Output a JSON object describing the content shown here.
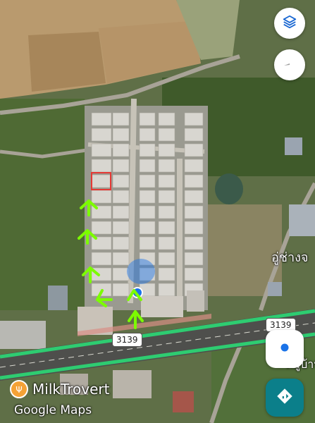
{
  "map": {
    "route_labels": [
      "3139",
      "3139"
    ],
    "place_label_right": "อู่ช่างจ",
    "place_label_right2": "หมู่บ้าน",
    "poi_name": "MilkTrovert",
    "attribution": "Google Maps"
  },
  "controls": {
    "layers_icon": "layers-icon",
    "compass_icon": "compass-icon",
    "location_icon": "my-location-icon",
    "directions_icon": "directions-icon"
  },
  "colors": {
    "road_highlight": "#2ecc71",
    "selection": "#e53935",
    "arrow": "#7CFC00",
    "location_blue": "#1a73e8",
    "directions_bg": "#0b7f8a"
  }
}
